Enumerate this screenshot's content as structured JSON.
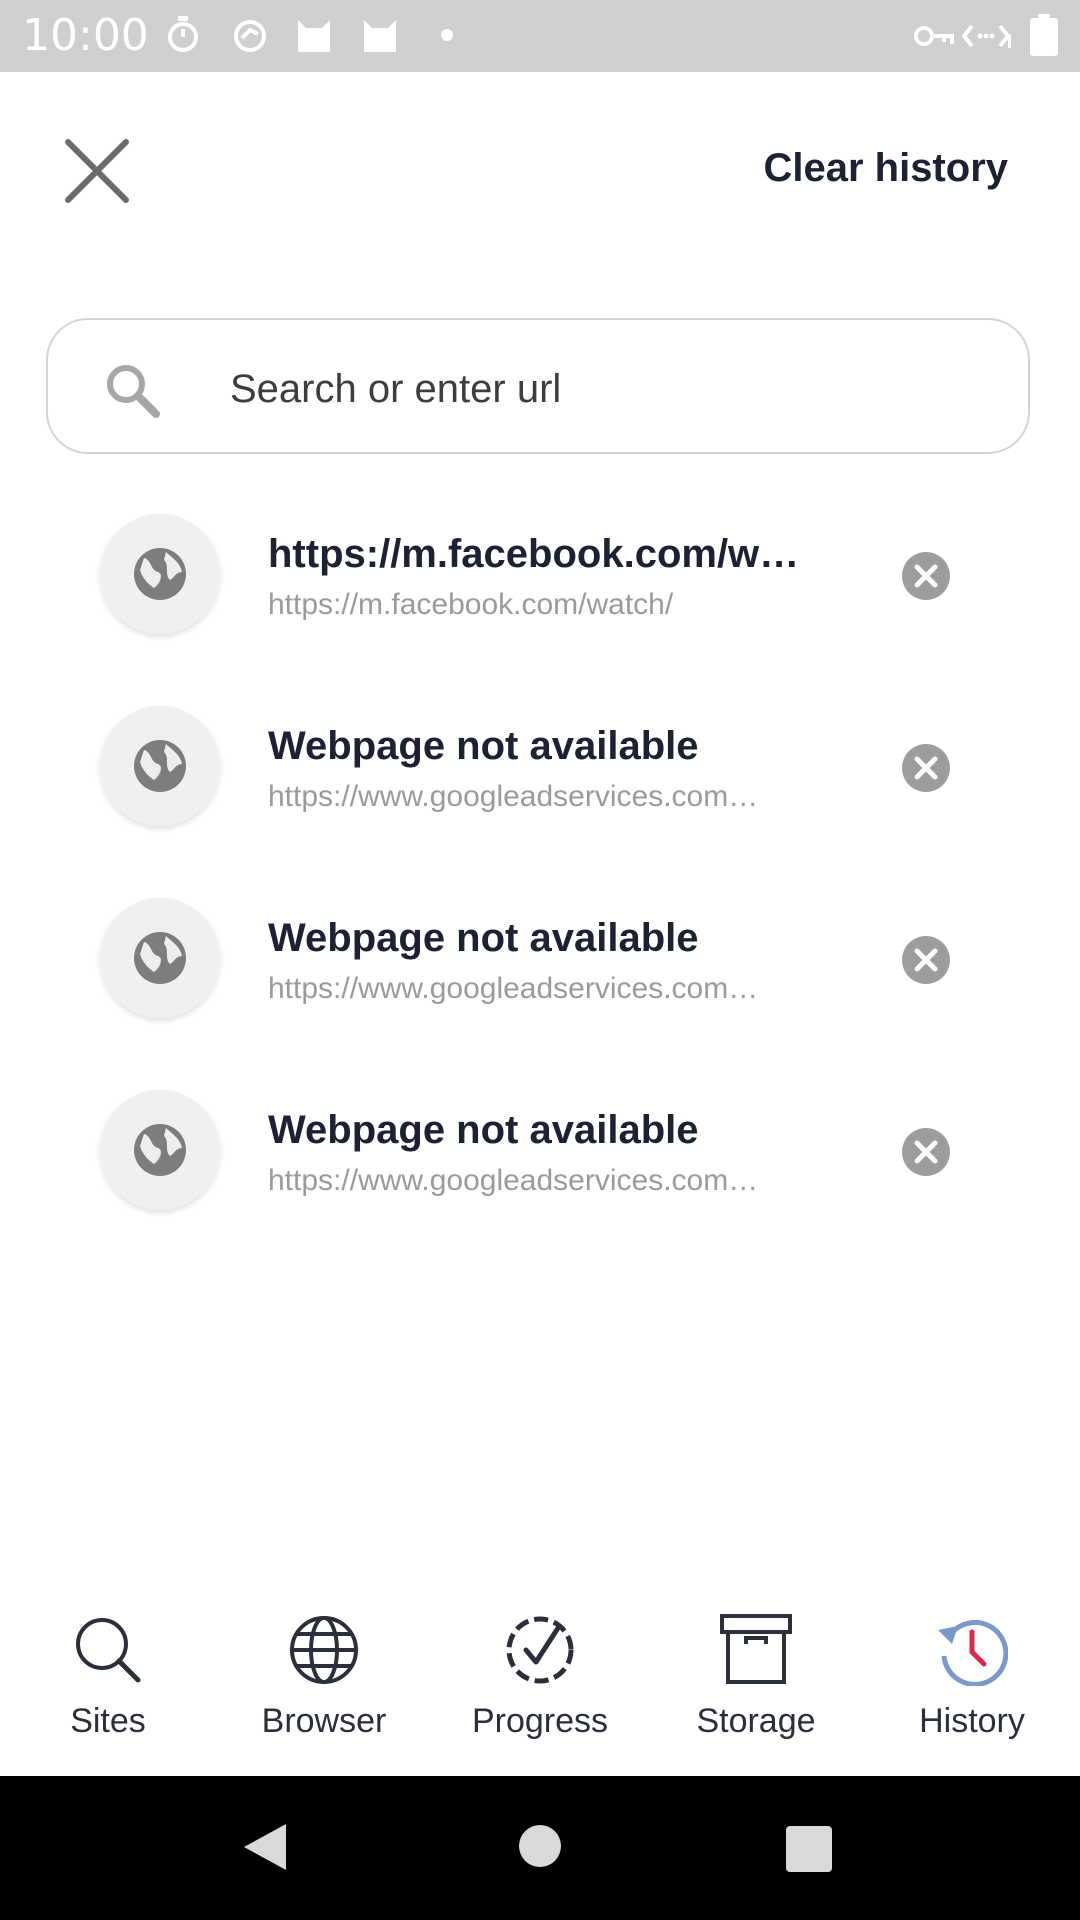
{
  "status_bar": {
    "time": "10:00",
    "left_icons": [
      "stopwatch-icon",
      "sync-icon",
      "cat-icon",
      "cat-icon",
      "dot-icon"
    ],
    "right_icons": [
      "vpn-key-icon",
      "data-saver-icon",
      "battery-icon"
    ]
  },
  "header": {
    "close_icon": "close-icon",
    "clear_history_label": "Clear history"
  },
  "search": {
    "placeholder": "Search or enter url",
    "icon": "search-icon"
  },
  "history": [
    {
      "title": "https://m.facebook.com/w…",
      "url": "https://m.facebook.com/watch/"
    },
    {
      "title": "Webpage not available",
      "url": "https://www.googleadservices.com…"
    },
    {
      "title": "Webpage not available",
      "url": "https://www.googleadservices.com…"
    },
    {
      "title": "Webpage not available",
      "url": "https://www.googleadservices.com…"
    }
  ],
  "bottom_nav": {
    "active": "History",
    "items": [
      {
        "label": "Sites",
        "icon": "search-icon"
      },
      {
        "label": "Browser",
        "icon": "globe-icon"
      },
      {
        "label": "Progress",
        "icon": "progress-check-icon"
      },
      {
        "label": "Storage",
        "icon": "archive-box-icon"
      },
      {
        "label": "History",
        "icon": "history-clock-icon"
      }
    ]
  },
  "colors": {
    "status_bar_bg": "#cfcfcf",
    "text_dark": "#1b2234",
    "url_gray": "#9a9a9a",
    "history_accent": "#e0264c",
    "history_ring": "#7a98c8"
  }
}
